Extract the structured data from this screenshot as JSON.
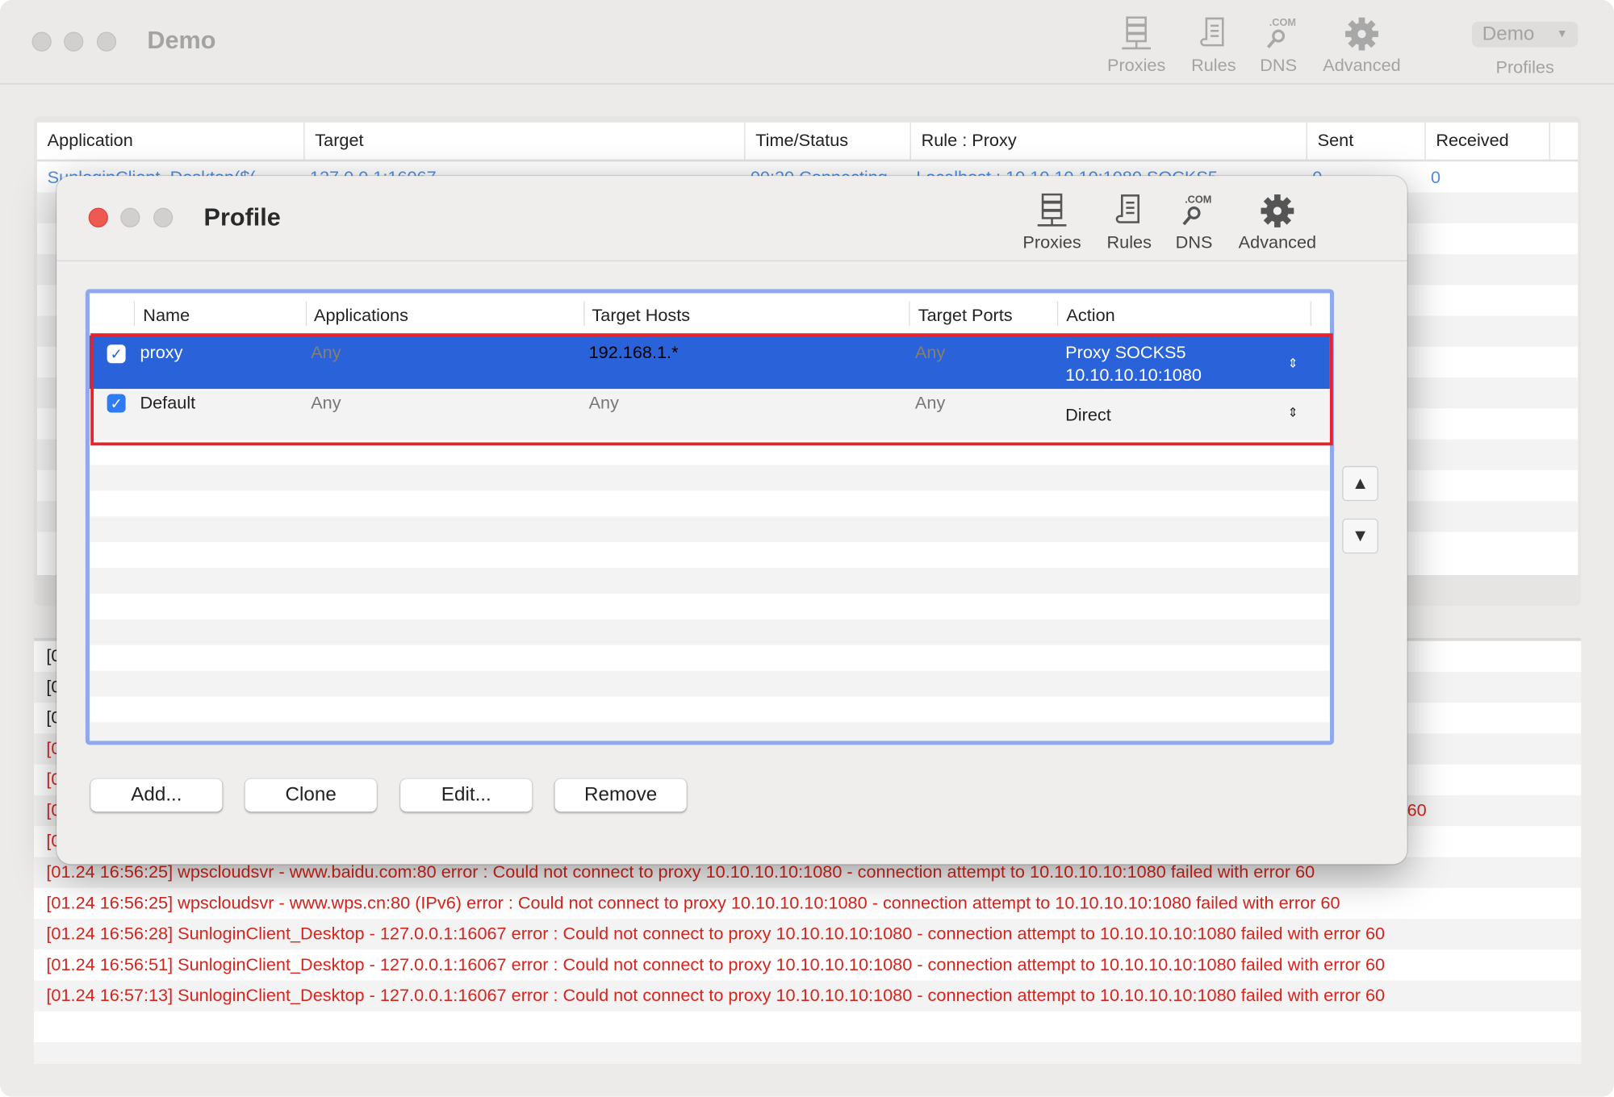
{
  "main_window": {
    "title": "Demo",
    "toolbar": [
      {
        "label": "Proxies",
        "icon": "server-icon"
      },
      {
        "label": "Rules",
        "icon": "scroll-icon"
      },
      {
        "label": "DNS",
        "icon": "dns-search-icon"
      },
      {
        "label": "Advanced",
        "icon": "gear-icon"
      }
    ],
    "profiles": {
      "selected": "Demo",
      "label": "Profiles"
    },
    "connections": {
      "columns": [
        "Application",
        "Target",
        "Time/Status",
        "Rule : Proxy",
        "Sent",
        "Received"
      ],
      "rows": [
        [
          "SunloginClient_Desktop($(",
          "127.0.0.1:16067",
          "00:20 Connecting",
          "Localhost : 10.10.10.10:1080 SOCKS5",
          "0",
          "0"
        ]
      ]
    },
    "log": {
      "hidden_prefix": "[0",
      "partial_suffix": "60",
      "lines": [
        "[01.24 16:56:25] wpscloudsvr - www.baidu.com:80 error : Could not connect to proxy 10.10.10.10:1080 - connection attempt to 10.10.10.10:1080 failed with error 60",
        "[01.24 16:56:25] wpscloudsvr - www.wps.cn:80 (IPv6) error : Could not connect to proxy 10.10.10.10:1080 - connection attempt to 10.10.10.10:1080 failed with error 60",
        "[01.24 16:56:28] SunloginClient_Desktop - 127.0.0.1:16067 error : Could not connect to proxy 10.10.10.10:1080 - connection attempt to 10.10.10.10:1080 failed with error 60",
        "[01.24 16:56:51] SunloginClient_Desktop - 127.0.0.1:16067 error : Could not connect to proxy 10.10.10.10:1080 - connection attempt to 10.10.10.10:1080 failed with error 60",
        "[01.24 16:57:13] SunloginClient_Desktop - 127.0.0.1:16067 error : Could not connect to proxy 10.10.10.10:1080 - connection attempt to 10.10.10.10:1080 failed with error 60"
      ]
    }
  },
  "profile_sheet": {
    "title": "Profile",
    "toolbar": [
      {
        "label": "Proxies",
        "icon": "server-icon"
      },
      {
        "label": "Rules",
        "icon": "scroll-icon"
      },
      {
        "label": "DNS",
        "icon": "dns-search-icon"
      },
      {
        "label": "Advanced",
        "icon": "gear-icon"
      }
    ],
    "rules_table": {
      "columns": [
        "Name",
        "Applications",
        "Target Hosts",
        "Target Ports",
        "Action"
      ],
      "rows": [
        {
          "enabled": true,
          "selected": true,
          "name": "proxy",
          "applications": "Any",
          "target_hosts": "192.168.1.*",
          "target_ports": "Any",
          "action_line1": "Proxy SOCKS5",
          "action_line2": "10.10.10.10:1080"
        },
        {
          "enabled": true,
          "selected": false,
          "name": "Default",
          "applications": "Any",
          "target_hosts": "Any",
          "target_ports": "Any",
          "action_line1": "Direct",
          "action_line2": ""
        }
      ]
    },
    "buttons": {
      "add": "Add...",
      "clone": "Clone",
      "edit": "Edit...",
      "remove": "Remove",
      "move_up": "▲",
      "move_down": "▼"
    },
    "colors": {
      "selection": "#2a62d9",
      "highlight_outline": "#e5232b",
      "focus_ring": "#8fa9ee",
      "error_text": "#d9241c"
    }
  }
}
